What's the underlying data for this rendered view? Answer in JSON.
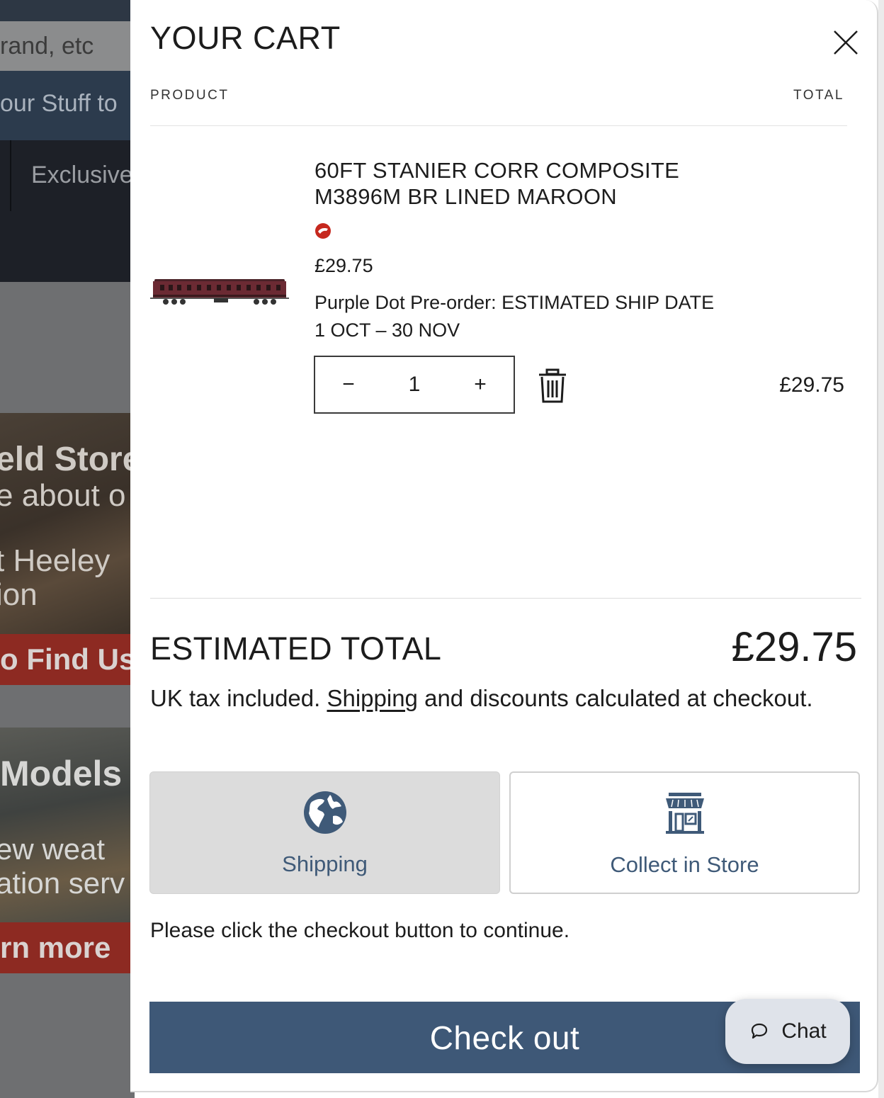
{
  "background": {
    "search_placeholder": "rand, etc",
    "sell_banner": "our Stuff to",
    "nav_item": "Exclusive",
    "store_title": "eld Store",
    "store_line1": "e about o",
    "store_line2": "t Heeley",
    "store_line3": "ion",
    "find_us": "o Find Us",
    "models_title": "Models",
    "models_line1": "ew weat",
    "models_line2": "ation serv",
    "learn_more": "rn more"
  },
  "cart": {
    "title": "YOUR CART",
    "columns": {
      "product": "PRODUCT",
      "total": "TOTAL"
    },
    "items": [
      {
        "name": "60FT STANIER CORR COMPOSITE M3896M BR LINED MAROON",
        "price": "£29.75",
        "preorder": "Purple Dot Pre-order: ESTIMATED SHIP DATE 1 OCT – 30 NOV",
        "quantity": "1",
        "decrement": "−",
        "increment": "+",
        "line_total": "£29.75"
      }
    ],
    "summary": {
      "label": "ESTIMATED TOTAL",
      "value": "£29.75",
      "tax_prefix": "UK tax included. ",
      "shipping_link": "Shipping",
      "tax_suffix": " and discounts calculated at checkout."
    },
    "delivery_options": [
      {
        "label": "Shipping",
        "icon": "globe-icon",
        "selected": true
      },
      {
        "label": "Collect in Store",
        "icon": "storefront-icon",
        "selected": false
      }
    ],
    "instruction": "Please click the checkout button to continue.",
    "checkout_label": "Check out"
  },
  "chat": {
    "label": "Chat"
  },
  "colors": {
    "accent": "#3e5877",
    "option_text": "#3f5a78",
    "badge": "#c6281e",
    "product_maroon": "#6b2a33"
  }
}
